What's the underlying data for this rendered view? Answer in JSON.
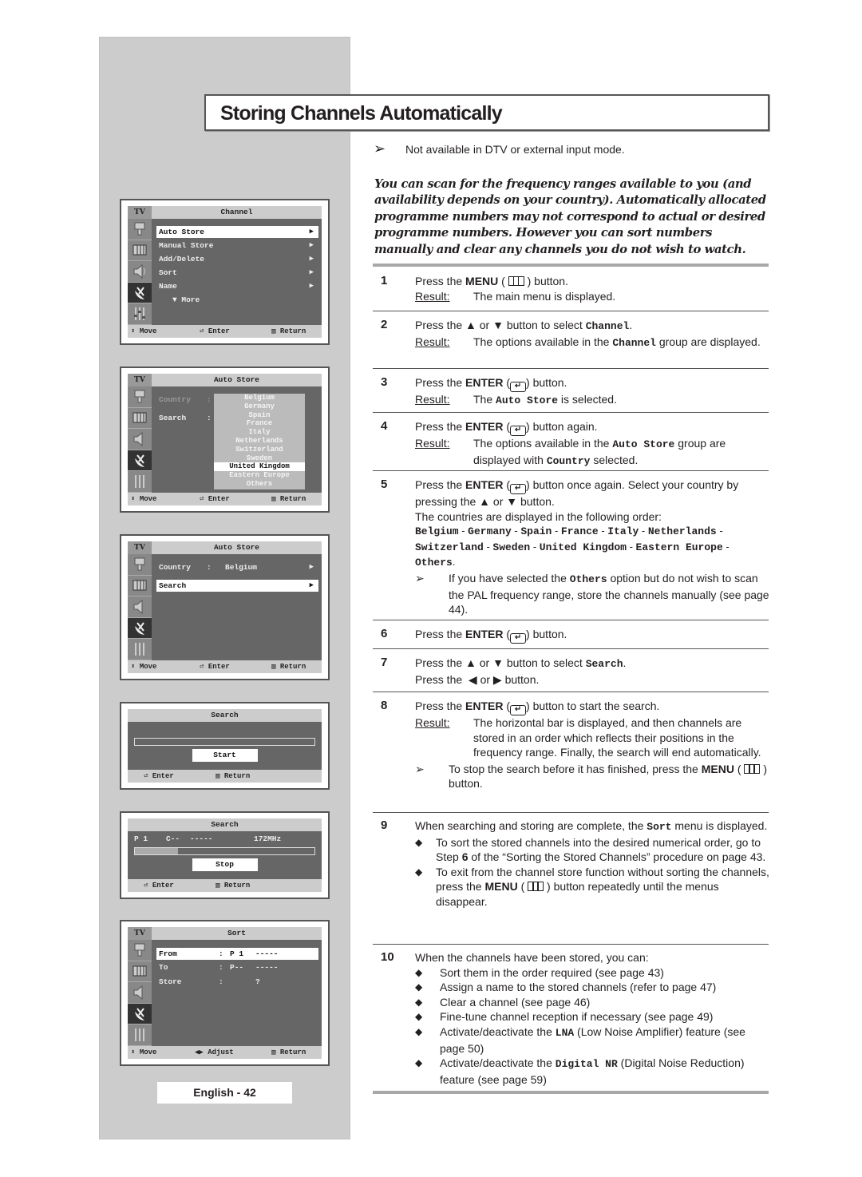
{
  "page": {
    "title": "Storing Channels Automatically",
    "footer": "English - 42"
  },
  "note_top": {
    "icon": "note-arrow-icon",
    "text": "Not available in DTV or external input mode."
  },
  "intro": "You can scan for the frequency ranges available to you (and availability depends on your country). Automatically allocated programme numbers may not correspond to actual or desired programme numbers. However you can sort numbers manually and clear any channels you do not wish to watch.",
  "labels": {
    "result": "Result:"
  },
  "steps": [
    {
      "num": "1",
      "line1_a": "Press the ",
      "line1_key": "MENU",
      "line1_b": " button.",
      "result": "The main menu is displayed."
    },
    {
      "num": "2",
      "line1_a": "Press the ▲ or ▼ button to select ",
      "line1_mono": "Channel",
      "line1_b": ".",
      "result_a": "The options available in the ",
      "result_mono": "Channel",
      "result_b": " group are displayed."
    },
    {
      "num": "3",
      "line1_a": "Press the ",
      "line1_key": "ENTER",
      "line1_b": " button.",
      "result_a": "The ",
      "result_mono": "Auto Store",
      "result_b": " is selected."
    },
    {
      "num": "4",
      "line1_a": "Press the ",
      "line1_key": "ENTER",
      "line1_b": " button again.",
      "result_a": "The options available in the ",
      "result_mono": "Auto Store",
      "result_b": " group are displayed with ",
      "result_mono2": "Country",
      "result_c": " selected."
    },
    {
      "num": "5",
      "line1_a": "Press the ",
      "line1_key": "ENTER",
      "line1_b": " button once again. Select your country by pressing the ▲ or ▼ button.",
      "line2": "The countries are displayed in the following order:",
      "countries": [
        "Belgium",
        "Germany",
        "Spain",
        "France",
        "Italy",
        "Netherlands",
        "Switzerland",
        "Sweden",
        "United Kingdom",
        "Eastern Europe",
        "Others"
      ],
      "note_a": "If you have selected the ",
      "note_mono": "Others",
      "note_b": " option but do not wish to scan the PAL frequency range, store the channels manually (see page 44)."
    },
    {
      "num": "6",
      "line1_a": "Press the ",
      "line1_key": "ENTER",
      "line1_b": " button."
    },
    {
      "num": "7",
      "line1_a": "Press the ▲ or ▼ button to select ",
      "line1_mono": "Search",
      "line1_b": ".",
      "line2": "Press the  ◀ or ▶ button."
    },
    {
      "num": "8",
      "line1_a": "Press the ",
      "line1_key": "ENTER",
      "line1_b": " button to start the search.",
      "result": "The horizontal bar is displayed, and then channels are stored in an order which reflects their positions in the frequency range. Finally, the search will end automatically.",
      "note_a": "To stop the search before it has finished, press the ",
      "note_key": "MENU",
      "note_b": " button."
    },
    {
      "num": "9",
      "line1_a": "When searching and storing are complete, the ",
      "line1_mono": "Sort",
      "line1_b": " menu is displayed.",
      "bullet1_a": "To sort the stored channels into the desired numerical order, go to Step ",
      "bullet1_key": "6",
      "bullet1_b": " of the “Sorting the Stored Channels” procedure on page 43.",
      "bullet2_a": "To exit from the channel store function without sorting the channels, press the ",
      "bullet2_key": "MENU",
      "bullet2_b": " button repeatedly until the menus disappear."
    },
    {
      "num": "10",
      "line1": "When the channels have been stored, you can:",
      "bullets": [
        {
          "text": "Sort them in the order required (see page 43)"
        },
        {
          "text": "Assign a name to the stored channels (refer to page 47)"
        },
        {
          "text": "Clear a channel (see page 46)"
        },
        {
          "text": "Fine-tune channel reception if necessary (see page 49)"
        },
        {
          "a": "Activate/deactivate the ",
          "mono": "LNA",
          "b": " (Low Noise Amplifier) feature (see page 50)"
        },
        {
          "a": "Activate/deactivate the ",
          "mono": "Digital NR",
          "b": " (Digital Noise Reduction) feature (see page 59)"
        }
      ]
    }
  ],
  "osd_common": {
    "tv": "TV",
    "move": "Move",
    "enter": "Enter",
    "return": "Return",
    "adjust": "Adjust",
    "sidebar_icons": [
      "picture-icon",
      "sound-bars-icon",
      "speaker-icon",
      "channel-antenna-icon",
      "setup-sliders-icon"
    ]
  },
  "osd1": {
    "title": "Channel",
    "items": [
      {
        "label": "Auto Store",
        "selected": true
      },
      {
        "label": "Manual Store"
      },
      {
        "label": "Add/Delete"
      },
      {
        "label": "Sort"
      },
      {
        "label": "Name"
      }
    ],
    "more": "▼ More"
  },
  "osd2": {
    "title": "Auto Store",
    "country_label": "Country",
    "search_label": "Search",
    "colon": ":",
    "options": [
      "Belgium",
      "Germany",
      "Spain",
      "France",
      "Italy",
      "Netherlands",
      "Switzerland",
      "Sweden",
      "United Kingdom",
      "Eastern Europe",
      "Others"
    ],
    "selected_option": "United Kingdom"
  },
  "osd3": {
    "title": "Auto Store",
    "country_label": "Country",
    "colon": ":",
    "country_value": "Belgium",
    "search_label": "Search"
  },
  "osd4": {
    "title": "Search",
    "button": "Start",
    "progress": 0
  },
  "osd5": {
    "title": "Search",
    "prog": "P  1",
    "channel": "C--",
    "name": "-----",
    "freq": "172MHz",
    "button": "Stop",
    "progress": 0.24
  },
  "osd6": {
    "title": "Sort",
    "rows": [
      {
        "label": "From",
        "colon": ":",
        "val1": "P 1",
        "val2": "-----"
      },
      {
        "label": "To",
        "colon": ":",
        "val1": "P--",
        "val2": "-----"
      },
      {
        "label": "Store",
        "colon": ":",
        "val1": "",
        "val2": "?"
      }
    ]
  }
}
